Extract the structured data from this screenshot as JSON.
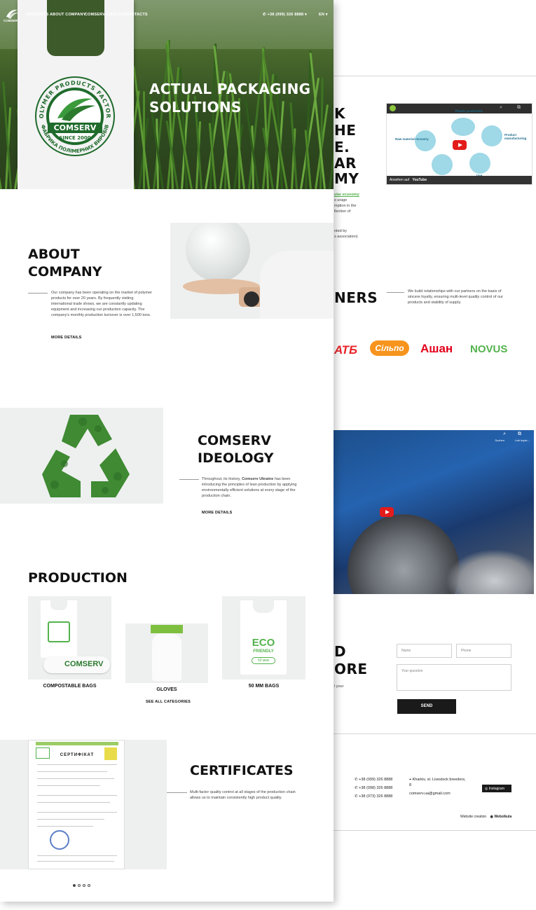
{
  "nav": {
    "logo_text": "COMSERV",
    "items": [
      "PRODUCTS",
      "ABOUT COMPANY",
      "COMSERV IDEOLOGY",
      "CONTACTS"
    ],
    "phone": "+38 (099) 326 8888",
    "lang": "EN"
  },
  "hero": {
    "title_line1": "ACTUAL PACKAGING",
    "title_line2": "SOLUTIONS",
    "emblem_top": "POLYMER PRODUCTS FACTORY",
    "emblem_brand": "COMSERV",
    "emblem_since": "SINCE 2000",
    "emblem_bottom": "ФАБРИКА ПОЛІМЕРНИХ ВИРОБІВ"
  },
  "about": {
    "title_line1": "ABOUT",
    "title_line2": "COMPANY",
    "text": "Our company has been operating on the market of polymer products for over 20 years. By frequently visiting international trade shows, we are constantly updating equipment and increasing our production capacity. The company's monthly production turnover is over 1,500 tons.",
    "more": "MORE DETAILS"
  },
  "ideology": {
    "title_line1": "COMSERV",
    "title_line2": "IDEOLOGY",
    "text_before": "Throughout, its history, ",
    "text_bold": "Comserv Ukraine",
    "text_after": " has been introducing the principles of lean production by applying environmentally efficient solutions at every stage of the production chain.",
    "more": "MORE DETAILS"
  },
  "production": {
    "title": "PRODUCTION",
    "items": [
      {
        "label": "COMPOSTABLE BAGS"
      },
      {
        "label": "GLOVES"
      },
      {
        "label": "50 MM BAGS"
      }
    ],
    "bag_text": "COMSERV",
    "eco_text": "ECO",
    "eco_sub": "FRIENDLY",
    "eco_badge": "50 мкм",
    "see_all": "SEE ALL CATEGORIES"
  },
  "certificates": {
    "title": "CERTIFICATES",
    "text": "Multi-factor quality control at all stages of the production chain allows us to maintain consistently high product quality.",
    "cert_heading": "СЕРТИФІКАТ"
  },
  "back": {
    "circular_fragments": [
      "K",
      "HE",
      "E.",
      "AR",
      "MY"
    ],
    "circular_link": "ular economy",
    "circular_text": [
      "s urage",
      "mption in the",
      "llection of"
    ],
    "circular_note": [
      "nted by",
      "s association)"
    ],
    "video1": {
      "bottom_left": "Ansehen auf",
      "youtube": "YouTube",
      "nodes": [
        "Plastic production",
        "Product manufacturing",
        "Raw material recovery",
        "Use",
        "Post use"
      ]
    },
    "partners_fragment": "NERS",
    "partners_text": "We build relationships with our partners on the basis of sincere loyalty, ensuring multi-level quality control of our products and stability of supply.",
    "partner_logos": [
      "АТБ",
      "Сільпо",
      "Ашан",
      "NOVUS"
    ],
    "video2_labels": [
      "Suchen",
      "Link kopie..."
    ],
    "contact_fragments": [
      "D",
      "ORE"
    ],
    "contact_small": "l your",
    "form": {
      "name_placeholder": "Name",
      "phone_placeholder": "Phone",
      "question_placeholder": "Your question",
      "send": "SEND"
    },
    "footer": {
      "phones": [
        "+38 (099) 326 8888",
        "+38 (098) 326 8888",
        "+38 (073) 326 8888"
      ],
      "address": "Kharkiv, st. Livestock breeders,",
      "address2": "8",
      "email": "comserv.ua@gmail.com",
      "instagram": "Instagram",
      "credit": "Website creation",
      "credit_brand": "Webolkula"
    }
  },
  "colors": {
    "accent_green": "#53b24c",
    "dark": "#111111",
    "card_bg": "#eef0ef"
  }
}
